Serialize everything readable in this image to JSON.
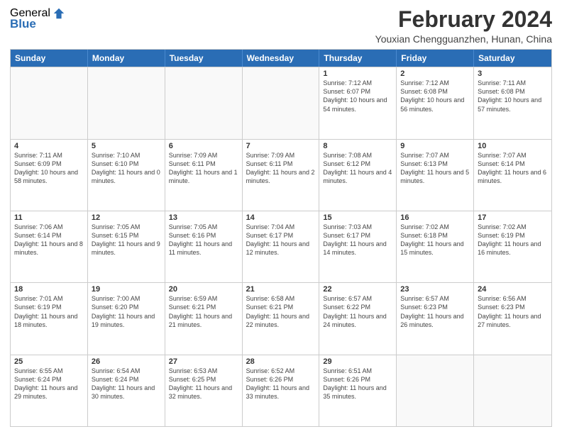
{
  "logo": {
    "general": "General",
    "blue": "Blue"
  },
  "title": "February 2024",
  "subtitle": "Youxian Chengguanzhen, Hunan, China",
  "days": [
    "Sunday",
    "Monday",
    "Tuesday",
    "Wednesday",
    "Thursday",
    "Friday",
    "Saturday"
  ],
  "weeks": [
    [
      {
        "day": "",
        "info": ""
      },
      {
        "day": "",
        "info": ""
      },
      {
        "day": "",
        "info": ""
      },
      {
        "day": "",
        "info": ""
      },
      {
        "day": "1",
        "info": "Sunrise: 7:12 AM\nSunset: 6:07 PM\nDaylight: 10 hours and 54 minutes."
      },
      {
        "day": "2",
        "info": "Sunrise: 7:12 AM\nSunset: 6:08 PM\nDaylight: 10 hours and 56 minutes."
      },
      {
        "day": "3",
        "info": "Sunrise: 7:11 AM\nSunset: 6:08 PM\nDaylight: 10 hours and 57 minutes."
      }
    ],
    [
      {
        "day": "4",
        "info": "Sunrise: 7:11 AM\nSunset: 6:09 PM\nDaylight: 10 hours and 58 minutes."
      },
      {
        "day": "5",
        "info": "Sunrise: 7:10 AM\nSunset: 6:10 PM\nDaylight: 11 hours and 0 minutes."
      },
      {
        "day": "6",
        "info": "Sunrise: 7:09 AM\nSunset: 6:11 PM\nDaylight: 11 hours and 1 minute."
      },
      {
        "day": "7",
        "info": "Sunrise: 7:09 AM\nSunset: 6:11 PM\nDaylight: 11 hours and 2 minutes."
      },
      {
        "day": "8",
        "info": "Sunrise: 7:08 AM\nSunset: 6:12 PM\nDaylight: 11 hours and 4 minutes."
      },
      {
        "day": "9",
        "info": "Sunrise: 7:07 AM\nSunset: 6:13 PM\nDaylight: 11 hours and 5 minutes."
      },
      {
        "day": "10",
        "info": "Sunrise: 7:07 AM\nSunset: 6:14 PM\nDaylight: 11 hours and 6 minutes."
      }
    ],
    [
      {
        "day": "11",
        "info": "Sunrise: 7:06 AM\nSunset: 6:14 PM\nDaylight: 11 hours and 8 minutes."
      },
      {
        "day": "12",
        "info": "Sunrise: 7:05 AM\nSunset: 6:15 PM\nDaylight: 11 hours and 9 minutes."
      },
      {
        "day": "13",
        "info": "Sunrise: 7:05 AM\nSunset: 6:16 PM\nDaylight: 11 hours and 11 minutes."
      },
      {
        "day": "14",
        "info": "Sunrise: 7:04 AM\nSunset: 6:17 PM\nDaylight: 11 hours and 12 minutes."
      },
      {
        "day": "15",
        "info": "Sunrise: 7:03 AM\nSunset: 6:17 PM\nDaylight: 11 hours and 14 minutes."
      },
      {
        "day": "16",
        "info": "Sunrise: 7:02 AM\nSunset: 6:18 PM\nDaylight: 11 hours and 15 minutes."
      },
      {
        "day": "17",
        "info": "Sunrise: 7:02 AM\nSunset: 6:19 PM\nDaylight: 11 hours and 16 minutes."
      }
    ],
    [
      {
        "day": "18",
        "info": "Sunrise: 7:01 AM\nSunset: 6:19 PM\nDaylight: 11 hours and 18 minutes."
      },
      {
        "day": "19",
        "info": "Sunrise: 7:00 AM\nSunset: 6:20 PM\nDaylight: 11 hours and 19 minutes."
      },
      {
        "day": "20",
        "info": "Sunrise: 6:59 AM\nSunset: 6:21 PM\nDaylight: 11 hours and 21 minutes."
      },
      {
        "day": "21",
        "info": "Sunrise: 6:58 AM\nSunset: 6:21 PM\nDaylight: 11 hours and 22 minutes."
      },
      {
        "day": "22",
        "info": "Sunrise: 6:57 AM\nSunset: 6:22 PM\nDaylight: 11 hours and 24 minutes."
      },
      {
        "day": "23",
        "info": "Sunrise: 6:57 AM\nSunset: 6:23 PM\nDaylight: 11 hours and 26 minutes."
      },
      {
        "day": "24",
        "info": "Sunrise: 6:56 AM\nSunset: 6:23 PM\nDaylight: 11 hours and 27 minutes."
      }
    ],
    [
      {
        "day": "25",
        "info": "Sunrise: 6:55 AM\nSunset: 6:24 PM\nDaylight: 11 hours and 29 minutes."
      },
      {
        "day": "26",
        "info": "Sunrise: 6:54 AM\nSunset: 6:24 PM\nDaylight: 11 hours and 30 minutes."
      },
      {
        "day": "27",
        "info": "Sunrise: 6:53 AM\nSunset: 6:25 PM\nDaylight: 11 hours and 32 minutes."
      },
      {
        "day": "28",
        "info": "Sunrise: 6:52 AM\nSunset: 6:26 PM\nDaylight: 11 hours and 33 minutes."
      },
      {
        "day": "29",
        "info": "Sunrise: 6:51 AM\nSunset: 6:26 PM\nDaylight: 11 hours and 35 minutes."
      },
      {
        "day": "",
        "info": ""
      },
      {
        "day": "",
        "info": ""
      }
    ]
  ]
}
